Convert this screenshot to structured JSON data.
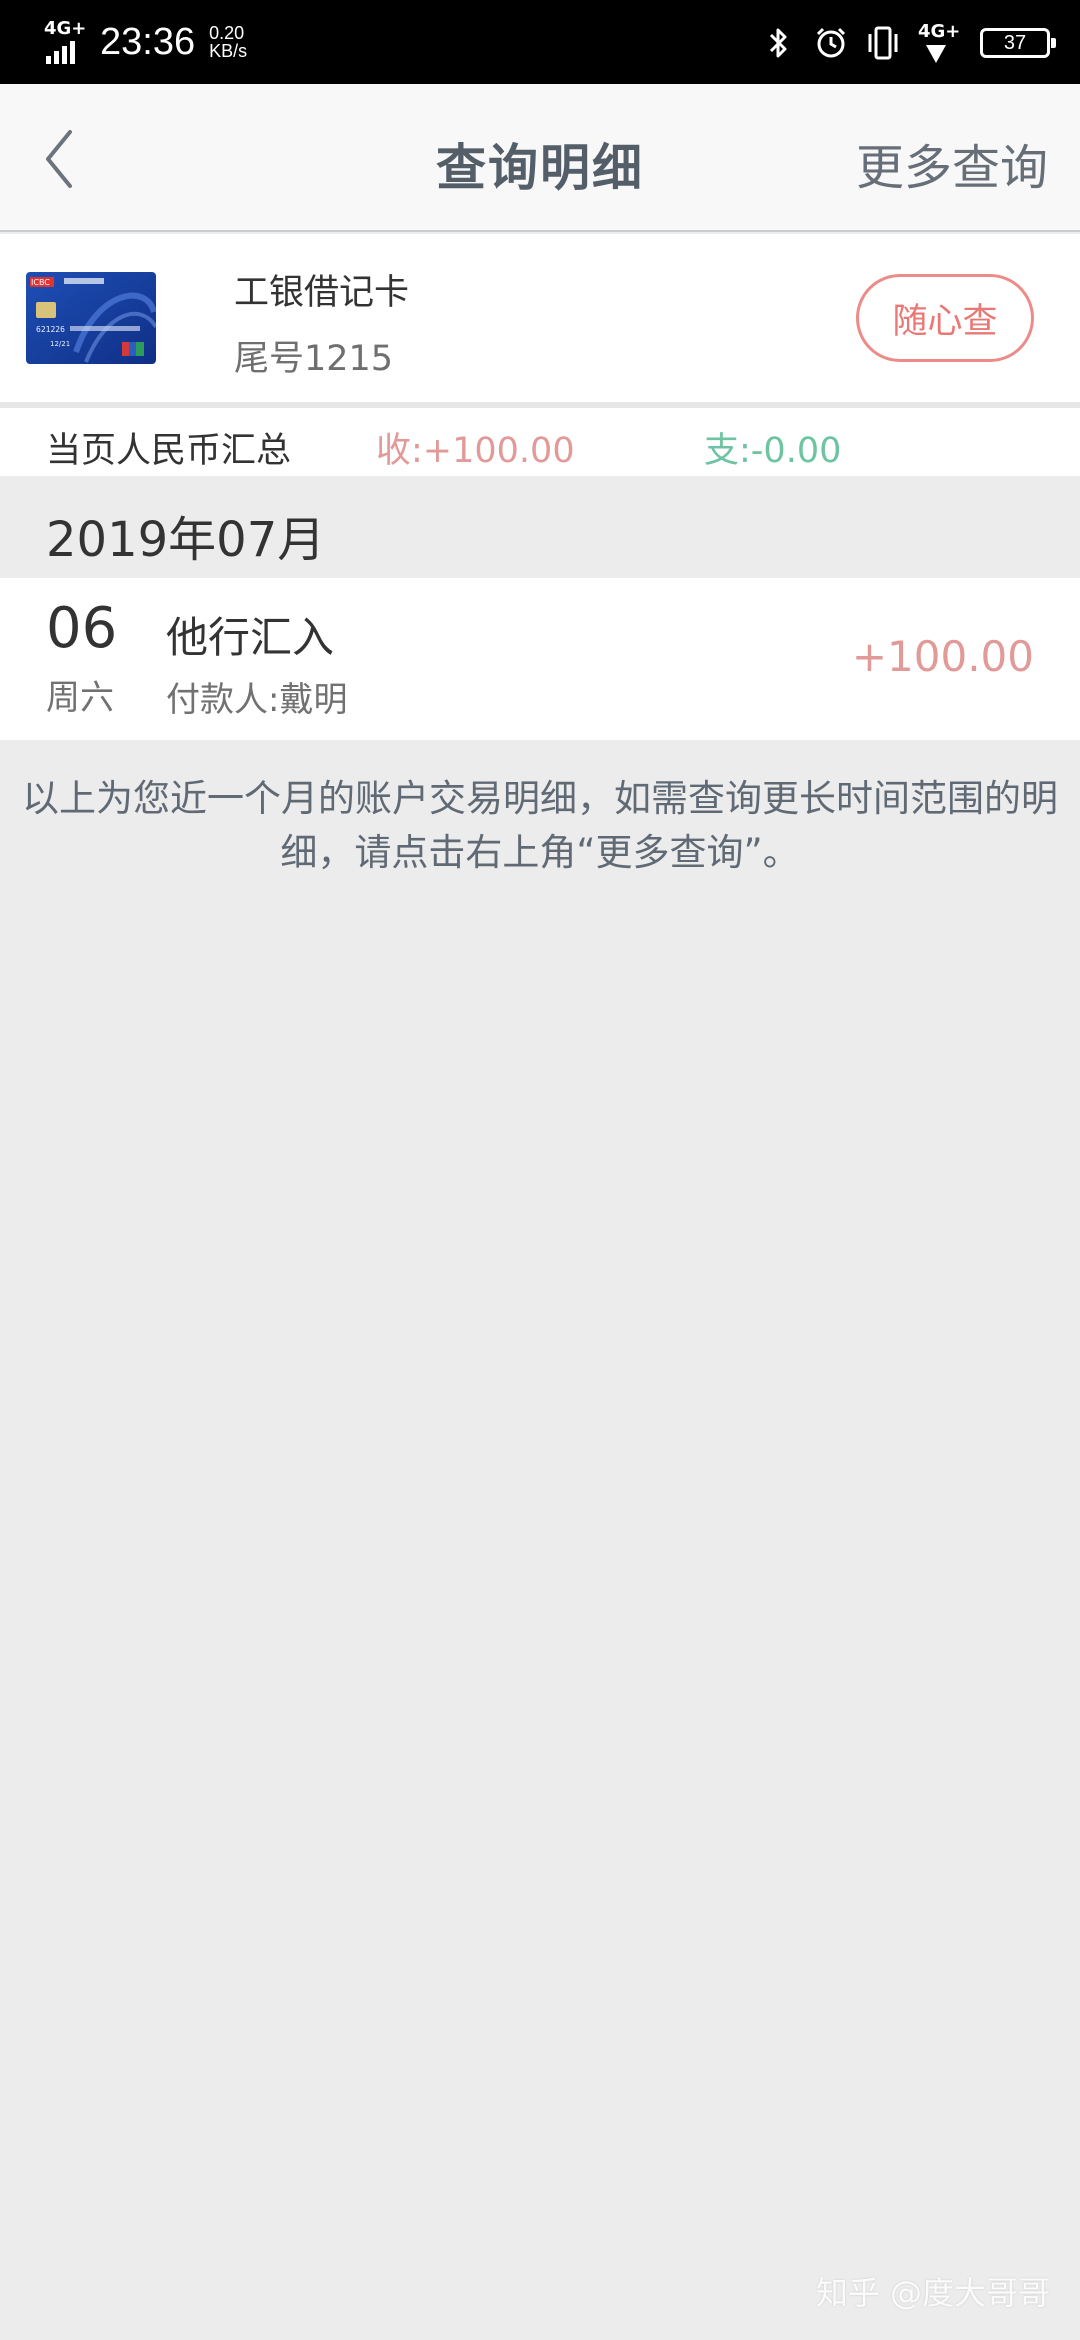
{
  "status_bar": {
    "network_left": "4G+",
    "time": "23:36",
    "speed_value": "0.20",
    "speed_unit": "KB/s",
    "network_right": "4G+",
    "battery": "37",
    "icons": [
      "bluetooth-icon",
      "alarm-icon",
      "vibrate-icon",
      "signal-icon",
      "battery-icon"
    ]
  },
  "nav": {
    "title": "查询明细",
    "more_label": "更多查询"
  },
  "card": {
    "name": "工银借记卡",
    "tail": "尾号1215",
    "query_button": "随心查",
    "card_logo_text": "ICBC",
    "card_number_partial": "621226",
    "card_expiry": "12/21"
  },
  "summary": {
    "label": "当页人民币汇总",
    "income": "收:+100.00",
    "expense": "支:-0.00"
  },
  "month_header": "2019年07月",
  "transactions": [
    {
      "day": "06",
      "weekday": "周六",
      "title": "他行汇入",
      "payer": "付款人:戴明",
      "amount": "+100.00"
    }
  ],
  "note": "以上为您近一个月的账户交易明细，如需查询更长时间范围的明细，请点击右上角“更多查询”。",
  "watermark": "知乎 @度大哥哥",
  "colors": {
    "accent_red": "#e97874",
    "income": "#e19a98",
    "expense": "#6ec4a2",
    "title": "#545e69"
  }
}
